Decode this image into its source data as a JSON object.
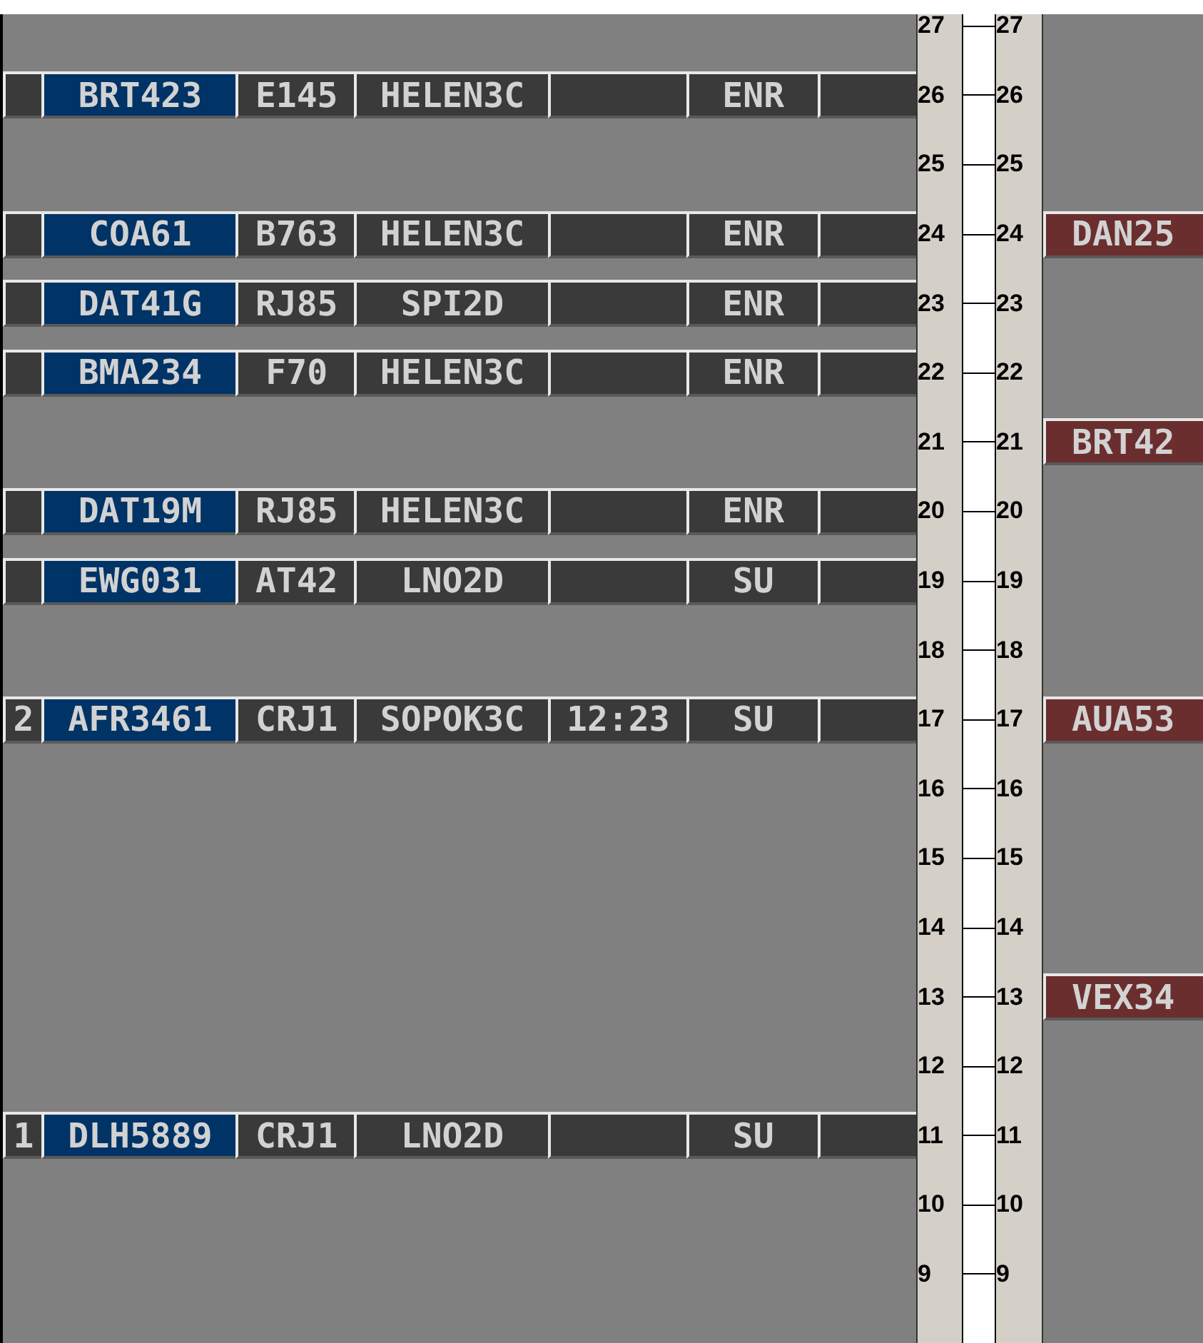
{
  "levels": [
    {
      "left_scale": "27",
      "right_scale": "27"
    },
    {
      "left_scale": "26",
      "right_scale": "26",
      "left_strip": {
        "callsign": "BRT423",
        "type": "E145",
        "route": "HELEN3C",
        "status": "ENR"
      }
    },
    {
      "left_scale": "25",
      "right_scale": "25"
    },
    {
      "left_scale": "24",
      "right_scale": "24",
      "left_strip": {
        "callsign": "COA61",
        "type": "B763",
        "route": "HELEN3C",
        "status": "ENR"
      },
      "right_strip": {
        "callsign": "DAN25"
      }
    },
    {
      "left_scale": "23",
      "right_scale": "23",
      "left_strip": {
        "callsign": "DAT41G",
        "type": "RJ85",
        "route": "SPI2D",
        "status": "ENR"
      }
    },
    {
      "left_scale": "22",
      "right_scale": "22",
      "left_strip": {
        "callsign": "BMA234",
        "type": "F70",
        "route": "HELEN3C",
        "status": "ENR"
      }
    },
    {
      "left_scale": "21",
      "right_scale": "21",
      "right_strip": {
        "callsign": "BRT42"
      }
    },
    {
      "left_scale": "20",
      "right_scale": "20",
      "left_strip": {
        "callsign": "DAT19M",
        "type": "RJ85",
        "route": "HELEN3C",
        "status": "ENR"
      }
    },
    {
      "left_scale": "19",
      "right_scale": "19",
      "left_strip": {
        "callsign": "EWG031",
        "type": "AT42",
        "route": "LNO2D",
        "status": "SU"
      }
    },
    {
      "left_scale": "18",
      "right_scale": "18"
    },
    {
      "left_scale": "17",
      "right_scale": "17",
      "left_strip": {
        "seq": "2",
        "callsign": "AFR3461",
        "type": "CRJ1",
        "route": "SOPOK3C",
        "time": "12:23",
        "status": "SU"
      },
      "right_strip": {
        "callsign": "AUA53"
      }
    },
    {
      "left_scale": "16",
      "right_scale": "16"
    },
    {
      "left_scale": "15",
      "right_scale": "15"
    },
    {
      "left_scale": "14",
      "right_scale": "14"
    },
    {
      "left_scale": "13",
      "right_scale": "13",
      "right_strip": {
        "callsign": "VEX34"
      }
    },
    {
      "left_scale": "12",
      "right_scale": "12"
    },
    {
      "left_scale": "11",
      "right_scale": "11",
      "left_strip": {
        "seq": "1",
        "callsign": "DLH5889",
        "type": "CRJ1",
        "route": "LNO2D",
        "status": "SU"
      }
    },
    {
      "left_scale": "10",
      "right_scale": "10"
    },
    {
      "left_scale": "9",
      "right_scale": "9"
    }
  ]
}
